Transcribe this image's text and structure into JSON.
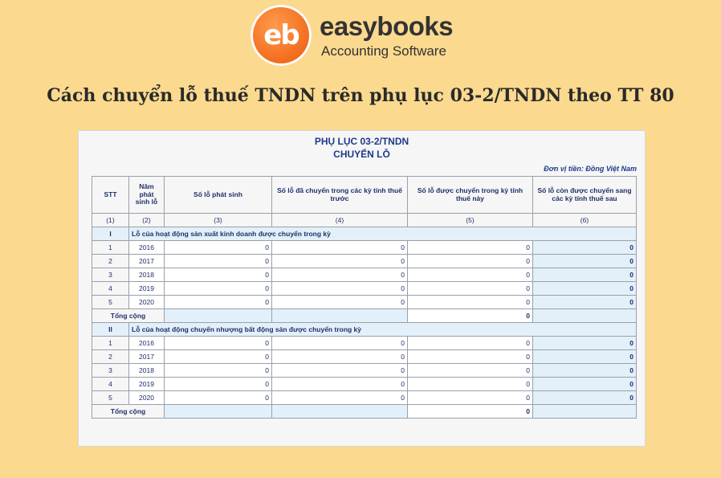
{
  "logo": {
    "mark": "eb",
    "name": "easybooks",
    "tagline": "Accounting Software"
  },
  "title": "Cách chuyển lỗ thuế TNDN trên phụ lục 03-2/TNDN theo TT 80",
  "form": {
    "heading1": "PHỤ LỤC 03-2/TNDN",
    "heading2": "CHUYỂN LỖ",
    "currency": "Đơn vị tiền: Đồng Việt Nam",
    "columns": [
      "STT",
      "Năm phát sinh lỗ",
      "Số lỗ phát sinh",
      "Số lỗ đã chuyển trong các kỳ tính thuế trước",
      "Số lỗ được chuyển trong kỳ tính thuế này",
      "Số lỗ còn được chuyển sang các kỳ tính thuế sau"
    ],
    "column_numbers": [
      "(1)",
      "(2)",
      "(3)",
      "(4)",
      "(5)",
      "(6)"
    ],
    "sections": [
      {
        "index": "I",
        "label": "Lỗ của hoạt động sản xuất kinh doanh được chuyển trong kỳ",
        "rows": [
          {
            "stt": "1",
            "year": "2016",
            "c3": "0",
            "c4": "0",
            "c5": "0",
            "c6": "0"
          },
          {
            "stt": "2",
            "year": "2017",
            "c3": "0",
            "c4": "0",
            "c5": "0",
            "c6": "0"
          },
          {
            "stt": "3",
            "year": "2018",
            "c3": "0",
            "c4": "0",
            "c5": "0",
            "c6": "0"
          },
          {
            "stt": "4",
            "year": "2019",
            "c3": "0",
            "c4": "0",
            "c5": "0",
            "c6": "0"
          },
          {
            "stt": "5",
            "year": "2020",
            "c3": "0",
            "c4": "0",
            "c5": "0",
            "c6": "0"
          }
        ],
        "total_label": "Tổng cộng",
        "total_value": "0"
      },
      {
        "index": "II",
        "label": "Lỗ của hoạt động chuyển nhượng bất động sản được chuyển trong kỳ",
        "rows": [
          {
            "stt": "1",
            "year": "2016",
            "c3": "0",
            "c4": "0",
            "c5": "0",
            "c6": "0"
          },
          {
            "stt": "2",
            "year": "2017",
            "c3": "0",
            "c4": "0",
            "c5": "0",
            "c6": "0"
          },
          {
            "stt": "3",
            "year": "2018",
            "c3": "0",
            "c4": "0",
            "c5": "0",
            "c6": "0"
          },
          {
            "stt": "4",
            "year": "2019",
            "c3": "0",
            "c4": "0",
            "c5": "0",
            "c6": "0"
          },
          {
            "stt": "5",
            "year": "2020",
            "c3": "0",
            "c4": "0",
            "c5": "0",
            "c6": "0"
          }
        ],
        "total_label": "Tổng cộng",
        "total_value": "0"
      }
    ]
  },
  "colors": {
    "background": "#fbd98f",
    "accent": "#f26a1b",
    "table_text": "#1f3a8a",
    "highlight": "#e3f0f9"
  }
}
